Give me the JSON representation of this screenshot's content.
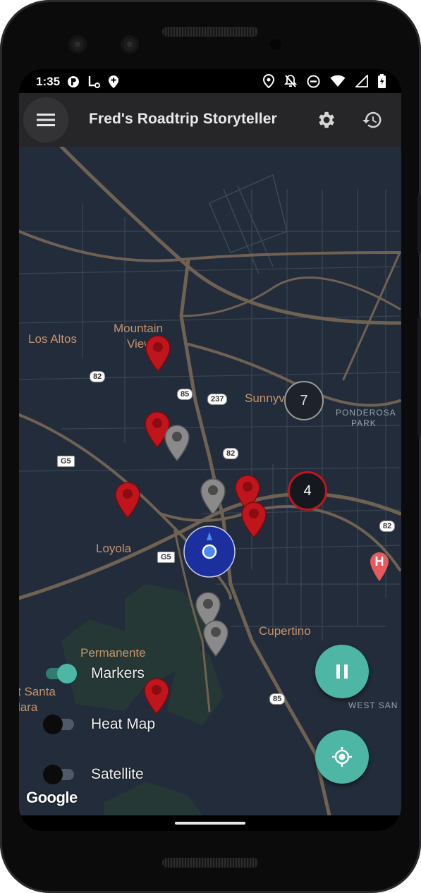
{
  "status_bar": {
    "time": "1:35",
    "left_icons": [
      "p-circle-icon",
      "tool-icon",
      "location-plus-icon"
    ],
    "right_icons": [
      "location-pin-icon",
      "bell-off-icon",
      "do-not-disturb-icon",
      "wifi-icon",
      "battery-charging-icon"
    ]
  },
  "app_bar": {
    "title": "Fred's Roadtrip Storyteller",
    "menu_icon": "hamburger-menu-icon",
    "settings_icon": "gear-icon",
    "history_icon": "history-icon"
  },
  "map": {
    "places": {
      "mountain_view_1": "Mountain",
      "mountain_view_2": "View",
      "los_altos": "Los Altos",
      "sunnyvale": "Sunnyvale",
      "loyola": "Loyola",
      "cupertino": "Cupertino",
      "permanente": "Permanente",
      "santa_clara_1": "t Santa",
      "santa_clara_2": "lara",
      "ponderosa_1": "PONDEROSA",
      "ponderosa_2": "PARK",
      "west_san": "WEST SAN"
    },
    "shields": {
      "r82_a": "82",
      "r85_a": "85",
      "r237": "237",
      "g5_a": "G5",
      "r82_b": "82",
      "r82_c": "82",
      "g5_b": "G5",
      "r85_b": "85"
    },
    "clusters": {
      "gray_count": "7",
      "red_count": "4"
    },
    "logo": "Google",
    "colors": {
      "map_bg": "#222c3b",
      "road": "#6f6252",
      "red_marker": "#c0151c",
      "gray_marker": "#8a8a8a",
      "location_ring": "#1c2f9e",
      "fab": "#4db6a4"
    }
  },
  "toggles": {
    "markers": {
      "label": "Markers",
      "on": true
    },
    "heat_map": {
      "label": "Heat Map",
      "on": false
    },
    "satellite": {
      "label": "Satellite",
      "on": false
    }
  },
  "fabs": {
    "pause_icon": "pause-icon",
    "locate_icon": "my-location-icon"
  }
}
